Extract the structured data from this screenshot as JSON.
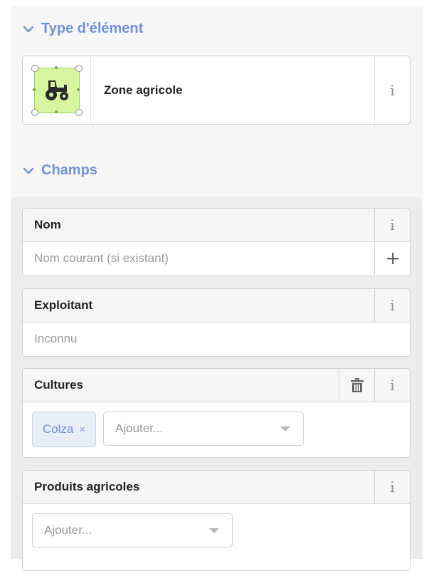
{
  "type_section": {
    "title": "Type d'élément",
    "preset": {
      "label": "Zone agricole",
      "icon": "tractor-icon"
    },
    "info_glyph": "i"
  },
  "fields_section": {
    "title": "Champs",
    "fields": {
      "nom": {
        "label": "Nom",
        "placeholder": "Nom courant (si existant)",
        "info": "i",
        "add": "+"
      },
      "exploitant": {
        "label": "Exploitant",
        "placeholder": "Inconnu",
        "info": "i"
      },
      "cultures": {
        "label": "Cultures",
        "chips": [
          "Colza"
        ],
        "chip_remove": "×",
        "combo_placeholder": "Ajouter...",
        "info": "i"
      },
      "produits": {
        "label": "Produits agricoles",
        "combo_placeholder": "Ajouter...",
        "info": "i"
      }
    }
  },
  "colors": {
    "accent": "#7092dc",
    "preset_fill": "#d8f5a0",
    "chip_bg": "#e8eef8"
  }
}
